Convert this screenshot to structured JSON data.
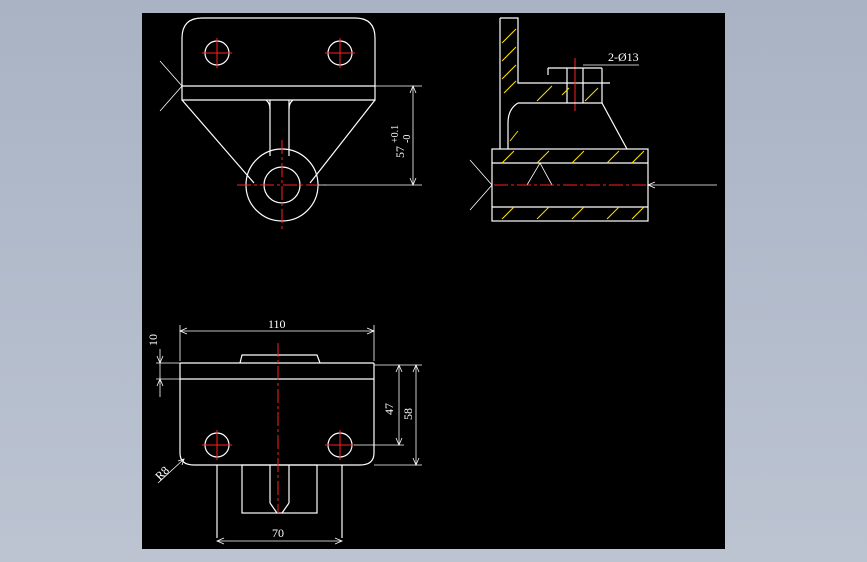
{
  "colors": {
    "background": "#a9b3c4",
    "sheet": "#000000",
    "outline": "#ffffff",
    "centerline": "#ff2020",
    "hatch": "#ffe000"
  },
  "dimensions": {
    "holes": "2-Ø13",
    "height_tol": "57",
    "tol_upper": "+0.1",
    "tol_lower": "-0",
    "width_top": "110",
    "offset_left": "10",
    "height_a": "47",
    "height_b": "58",
    "radius": "R8",
    "width_bottom": "70"
  }
}
